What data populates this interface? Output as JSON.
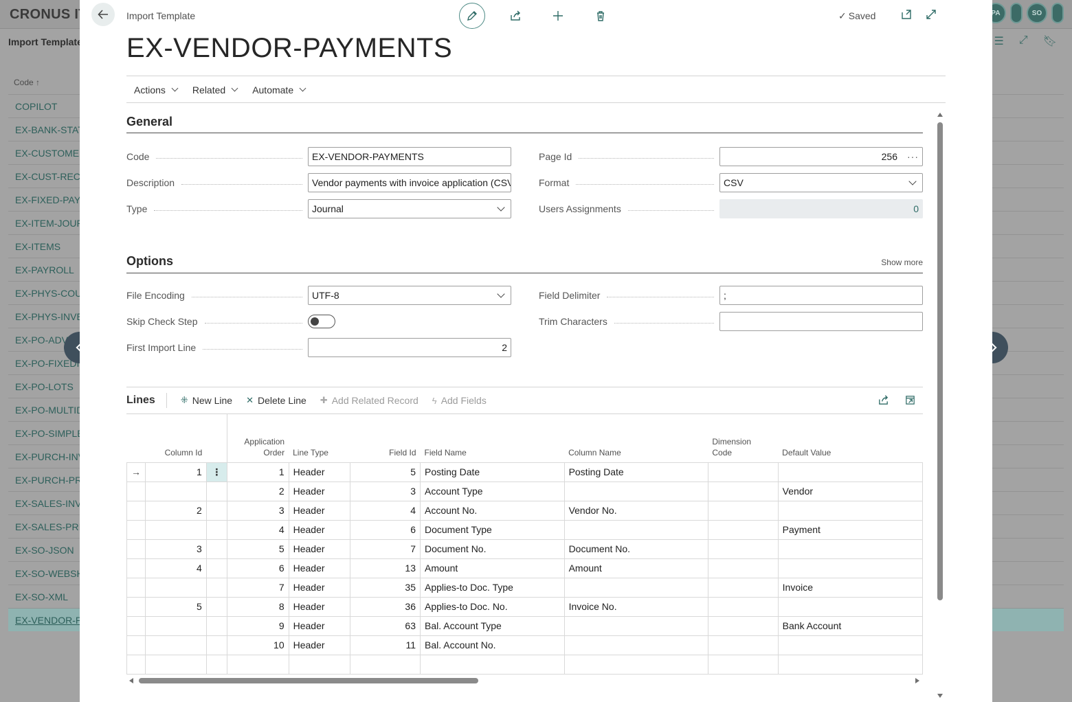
{
  "background": {
    "brand": "CRONUS IT",
    "avatars": [
      "PA",
      "SO"
    ],
    "page_title": "Import Template",
    "column_header": "Code ↑",
    "items": [
      "COPILOT",
      "EX-BANK-STATE",
      "EX-CUSTOMERS",
      "EX-CUST-RECEI",
      "EX-FIXED-PAYR",
      "EX-ITEM-JOURN",
      "EX-ITEMS",
      "EX-PAYROLL",
      "EX-PHYS-COUN",
      "EX-PHYS-INVEN",
      "EX-PO-ADV",
      "EX-PO-FIXEDI",
      "EX-PO-LOTS",
      "EX-PO-MULTID",
      "EX-PO-SIMPLE",
      "EX-PURCH-INV",
      "EX-PURCH-PRIC",
      "EX-SALES-INVC",
      "EX-SALES-PRIC",
      "EX-SO-JSON",
      "EX-SO-WEBSHO",
      "EX-SO-XML",
      "EX-VENDOR-PA"
    ],
    "selected_index": 22
  },
  "dialog": {
    "breadcrumb": "Import Template",
    "saved_label": "Saved",
    "title": "EX-VENDOR-PAYMENTS",
    "actions": [
      "Actions",
      "Related",
      "Automate"
    ],
    "accent_color": "#2e6b66"
  },
  "general": {
    "heading": "General",
    "code_label": "Code",
    "code_value": "EX-VENDOR-PAYMENTS",
    "description_label": "Description",
    "description_value": "Vendor payments with invoice application (CSV)",
    "type_label": "Type",
    "type_value": "Journal",
    "page_id_label": "Page Id",
    "page_id_value": "256",
    "format_label": "Format",
    "format_value": "CSV",
    "users_label": "Users Assignments",
    "users_value": "0"
  },
  "options": {
    "heading": "Options",
    "show_more": "Show more",
    "file_encoding_label": "File Encoding",
    "file_encoding_value": "UTF-8",
    "skip_check_label": "Skip Check Step",
    "skip_check_on": false,
    "first_import_label": "First Import Line",
    "first_import_value": "2",
    "field_delimiter_label": "Field Delimiter",
    "field_delimiter_value": ";",
    "trim_label": "Trim Characters",
    "trim_value": ""
  },
  "lines": {
    "title": "Lines",
    "new_line": "New Line",
    "delete_line": "Delete Line",
    "add_related": "Add Related Record",
    "add_fields": "Add Fields",
    "columns": {
      "column_id": "Column Id",
      "app_order_1": "Application",
      "app_order_2": "Order",
      "line_type": "Line Type",
      "field_id": "Field Id",
      "field_name": "Field Name",
      "column_name": "Column Name",
      "dim_code_1": "Dimension",
      "dim_code_2": "Code",
      "default_value": "Default Value"
    },
    "rows": [
      {
        "column_id": "1",
        "order": "1",
        "line_type": "Header",
        "field_id": "5",
        "field_name": "Posting Date",
        "column_name": "Posting Date",
        "dimension": "",
        "default": ""
      },
      {
        "column_id": "",
        "order": "2",
        "line_type": "Header",
        "field_id": "3",
        "field_name": "Account Type",
        "column_name": "",
        "dimension": "",
        "default": "Vendor"
      },
      {
        "column_id": "2",
        "order": "3",
        "line_type": "Header",
        "field_id": "4",
        "field_name": "Account No.",
        "column_name": "Vendor No.",
        "dimension": "",
        "default": ""
      },
      {
        "column_id": "",
        "order": "4",
        "line_type": "Header",
        "field_id": "6",
        "field_name": "Document Type",
        "column_name": "",
        "dimension": "",
        "default": "Payment"
      },
      {
        "column_id": "3",
        "order": "5",
        "line_type": "Header",
        "field_id": "7",
        "field_name": "Document No.",
        "column_name": "Document No.",
        "dimension": "",
        "default": ""
      },
      {
        "column_id": "4",
        "order": "6",
        "line_type": "Header",
        "field_id": "13",
        "field_name": "Amount",
        "column_name": "Amount",
        "dimension": "",
        "default": ""
      },
      {
        "column_id": "",
        "order": "7",
        "line_type": "Header",
        "field_id": "35",
        "field_name": "Applies-to Doc. Type",
        "column_name": "",
        "dimension": "",
        "default": "Invoice"
      },
      {
        "column_id": "5",
        "order": "8",
        "line_type": "Header",
        "field_id": "36",
        "field_name": "Applies-to Doc. No.",
        "column_name": "Invoice No.",
        "dimension": "",
        "default": ""
      },
      {
        "column_id": "",
        "order": "9",
        "line_type": "Header",
        "field_id": "63",
        "field_name": "Bal. Account Type",
        "column_name": "",
        "dimension": "",
        "default": "Bank Account"
      },
      {
        "column_id": "",
        "order": "10",
        "line_type": "Header",
        "field_id": "11",
        "field_name": "Bal. Account No.",
        "column_name": "",
        "dimension": "",
        "default": ""
      }
    ]
  }
}
